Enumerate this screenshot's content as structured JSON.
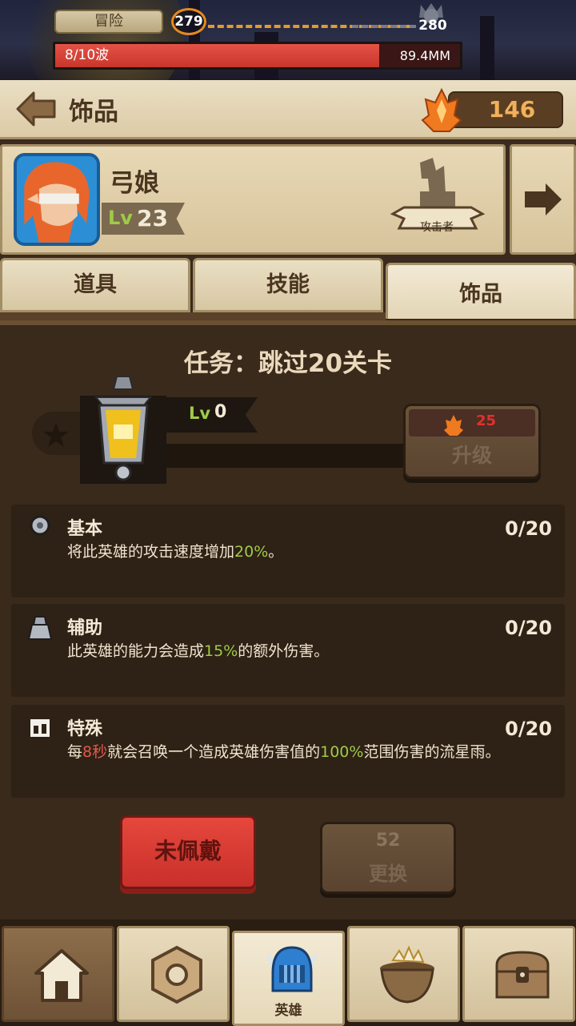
{
  "top_bar": {
    "mode": "冒险",
    "current_stage": "279",
    "next_stage": "280",
    "wave": "8/10波",
    "hp": "89.4MM",
    "wave_progress": 0.8
  },
  "header": {
    "title": "饰品",
    "gems": "146"
  },
  "hero": {
    "name": "弓娘",
    "level_label": "Lv",
    "level": "23",
    "role": "攻击者"
  },
  "tabs": [
    {
      "label": "道具"
    },
    {
      "label": "技能"
    },
    {
      "label": "饰品",
      "active": true
    }
  ],
  "accessory": {
    "quest": "任务：跳过20关卡",
    "level_label": "Lv",
    "level": "0",
    "upgrade_cost": "25",
    "upgrade_label": "升级"
  },
  "abilities": [
    {
      "name": "基本",
      "progress": "0/20",
      "desc_before": "将此英雄的攻击速度增加",
      "highlight": "20%",
      "desc_after": "。"
    },
    {
      "name": "辅助",
      "progress": "0/20",
      "desc_before": "此英雄的能力会造成",
      "highlight": "15%",
      "desc_after": "的额外伤害。"
    },
    {
      "name": "特殊",
      "progress": "0/20",
      "desc_prefix": "每",
      "highlight_red": "8秒",
      "desc_middle": "就会召唤一个造成英雄伤害值的",
      "highlight": "100%",
      "desc_after": "范围伤害的流星雨。"
    }
  ],
  "actions": {
    "equip_label": "未佩戴",
    "replace_cost": "52",
    "replace_label": "更换"
  },
  "nav": {
    "hero_label": "英雄"
  },
  "colors": {
    "accent_green": "#9fcb47",
    "accent_red": "#e0322b",
    "equip_red": "#c9302a",
    "gem_orange": "#f3b05a"
  },
  "icons": [
    "back-arrow-icon",
    "fire-gem-icon",
    "attacker-role-icon",
    "next-arrow-icon",
    "lantern-icon",
    "star-icon",
    "gem-icon",
    "home-icon",
    "nut-icon",
    "helmet-icon",
    "cauldron-icon",
    "chest-icon"
  ]
}
